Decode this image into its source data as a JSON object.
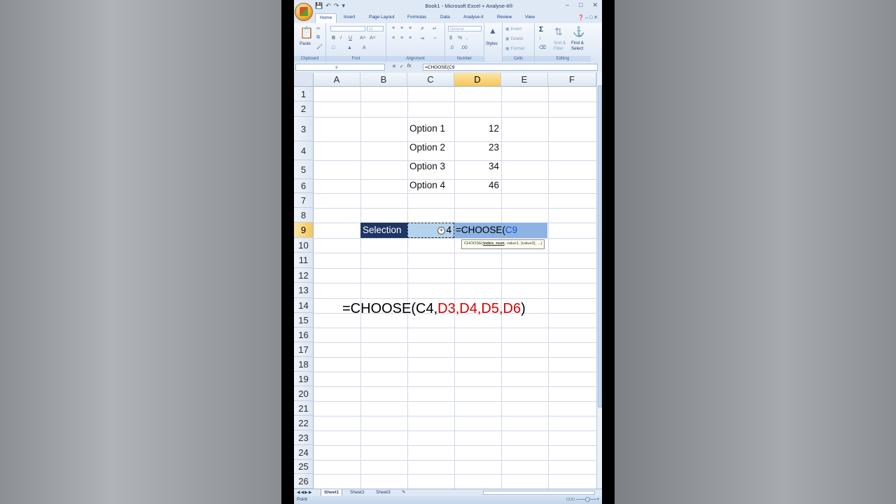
{
  "window": {
    "title": "Book1 - Microsoft Excel + Analyse-it®",
    "controls": [
      "–",
      "□",
      "✕"
    ]
  },
  "ribbon": {
    "tabs": [
      "Home",
      "Insert",
      "Page Layout",
      "Formulas",
      "Data",
      "Analyse-it",
      "Review",
      "View"
    ],
    "groups": {
      "clipboard": "Clipboard",
      "font": "Font",
      "alignment": "Alignment",
      "number": "Number",
      "cells": "Cells",
      "editing": "Editing"
    },
    "paste_label": "Paste",
    "font_size": "11",
    "number_format": "General",
    "styles_label": "Styles",
    "insert_label": "Insert",
    "delete_label": "Delete",
    "format_label": "Format",
    "sort_label": "Sort &",
    "filter_label": "Filter",
    "find_label": "Find &",
    "select_label": "Select"
  },
  "formula_bar": {
    "name_box": "",
    "fx": "fx",
    "content": "=CHOOSE(C9"
  },
  "columns": [
    "A",
    "B",
    "C",
    "D",
    "E",
    "F"
  ],
  "rows": [
    "1",
    "2",
    "3",
    "4",
    "5",
    "6",
    "7",
    "8",
    "9",
    "10",
    "11",
    "12",
    "13",
    "14",
    "15",
    "16",
    "17",
    "18",
    "19",
    "20",
    "21",
    "22",
    "23",
    "24",
    "25",
    "26"
  ],
  "cells": {
    "C3": "Option 1",
    "D3": "12",
    "C4": "Option 2",
    "D4": "23",
    "C5": "Option 3",
    "D5": "34",
    "C6": "Option 4",
    "D6": "46",
    "B9": "Selection",
    "C9": "4",
    "D9_prefix": "=CHOOSE(",
    "D9_ref": "C9"
  },
  "tooltip": {
    "prefix": "CHOOSE(",
    "bold_arg": "index_num",
    "rest": ", value1, [value2], ...)"
  },
  "annotation": {
    "prefix": "=CHOOSE(C4,",
    "refs": "D3,D4,D5,D6",
    "suffix": ")"
  },
  "sheets": [
    "Sheet1",
    "Sheet2",
    "Sheet3"
  ],
  "status": {
    "mode": "Point"
  }
}
